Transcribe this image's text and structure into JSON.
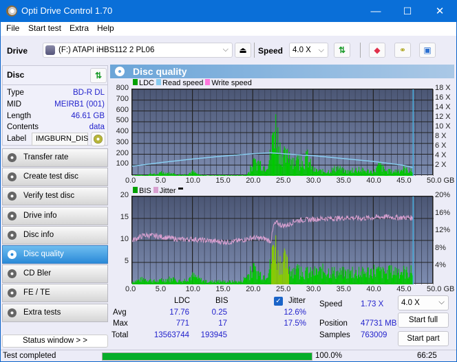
{
  "window": {
    "title": "Opti Drive Control 1.70",
    "minimize": "—",
    "maximize": "☐",
    "close": "✕"
  },
  "menu": [
    "File",
    "Start test",
    "Extra",
    "Help"
  ],
  "toolbar": {
    "drive_label": "Drive",
    "drive_value": "(F:)  ATAPI iHBS112  2 PL06",
    "speed_label": "Speed",
    "speed_value": "4.0 X",
    "icons": [
      "eject-icon",
      "refresh-icon",
      "eraser-icon",
      "copy-icon",
      "save-icon"
    ]
  },
  "disc": {
    "header": "Disc",
    "fields": [
      {
        "label": "Type",
        "value": "BD-R DL"
      },
      {
        "label": "MID",
        "value": "MEIRB1 (001)"
      },
      {
        "label": "Length",
        "value": "46.61 GB"
      },
      {
        "label": "Contents",
        "value": "data"
      }
    ],
    "label_label": "Label",
    "label_value": "IMGBURN_DIS"
  },
  "nav": [
    {
      "label": "Transfer rate",
      "active": false
    },
    {
      "label": "Create test disc",
      "active": false
    },
    {
      "label": "Verify test disc",
      "active": false
    },
    {
      "label": "Drive info",
      "active": false
    },
    {
      "label": "Disc info",
      "active": false
    },
    {
      "label": "Disc quality",
      "active": true
    },
    {
      "label": "CD Bler",
      "active": false
    },
    {
      "label": "FE / TE",
      "active": false
    },
    {
      "label": "Extra tests",
      "active": false
    }
  ],
  "status_window_button": "Status window > >",
  "panel_title": "Disc quality",
  "chart_data": [
    {
      "type": "bar",
      "title": "LDC / Read speed",
      "legend": [
        {
          "name": "LDC",
          "color": "#00a000"
        },
        {
          "name": "Read speed",
          "color": "#88ccf0"
        },
        {
          "name": "Write speed",
          "color": "#ff77dd"
        }
      ],
      "legend_position": "top-left",
      "xlabel": "GB",
      "xlim": [
        0,
        50
      ],
      "x_ticks": [
        "0.0",
        "5.0",
        "10.0",
        "15.0",
        "20.0",
        "25.0",
        "30.0",
        "35.0",
        "40.0",
        "45.0",
        "50.0 GB"
      ],
      "ylim": [
        0,
        800
      ],
      "y_ticks": [
        "800",
        "700",
        "600",
        "500",
        "400",
        "300",
        "200",
        "100"
      ],
      "y2lim": [
        0,
        18
      ],
      "y2_ticks": [
        "18 X",
        "16 X",
        "14 X",
        "12 X",
        "10 X",
        "8 X",
        "6 X",
        "4 X",
        "2 X"
      ],
      "grid": true,
      "end_marker_x": 46.61,
      "series": [
        {
          "name": "LDC",
          "x": [
            0,
            1,
            2,
            3,
            4,
            5,
            6,
            7,
            8,
            9,
            10,
            11,
            12,
            13,
            14,
            15,
            16,
            17,
            18,
            19,
            20,
            21,
            22,
            23,
            23.5,
            24,
            24.5,
            25,
            25.5,
            26,
            27,
            28,
            29,
            30,
            31,
            32,
            33,
            34,
            35,
            36,
            37,
            38,
            39,
            40,
            41,
            42,
            43,
            44,
            45,
            46,
            46.6
          ],
          "values": [
            5,
            15,
            10,
            30,
            20,
            50,
            40,
            20,
            15,
            25,
            60,
            15,
            10,
            8,
            10,
            12,
            10,
            10,
            12,
            15,
            160,
            200,
            120,
            300,
            771,
            600,
            380,
            300,
            250,
            330,
            200,
            180,
            250,
            80,
            70,
            60,
            80,
            120,
            70,
            60,
            90,
            80,
            70,
            60,
            150,
            70,
            60,
            80,
            100,
            70,
            60
          ]
        },
        {
          "name": "Read speed",
          "unit": "X",
          "x": [
            0,
            5,
            10,
            15,
            20,
            23,
            25,
            30,
            35,
            40,
            45,
            46.6
          ],
          "values": [
            2.0,
            2.8,
            3.5,
            4.1,
            4.6,
            4.8,
            4.6,
            4.2,
            3.6,
            3.0,
            2.2,
            1.73
          ]
        }
      ]
    },
    {
      "type": "bar",
      "title": "BIS / Jitter",
      "legend": [
        {
          "name": "BIS",
          "color": "#00a000"
        },
        {
          "name": "Jitter",
          "color": "#d8a0d0"
        }
      ],
      "legend_position": "top-left",
      "xlabel": "GB",
      "xlim": [
        0,
        50
      ],
      "x_ticks": [
        "0.0",
        "5.0",
        "10.0",
        "15.0",
        "20.0",
        "25.0",
        "30.0",
        "35.0",
        "40.0",
        "45.0",
        "50.0 GB"
      ],
      "ylim": [
        0,
        20
      ],
      "y_ticks": [
        "20",
        "15",
        "10",
        "5"
      ],
      "y2lim": [
        0,
        20
      ],
      "y2_ticks": [
        "20%",
        "16%",
        "12%",
        "8%",
        "4%"
      ],
      "grid": true,
      "end_marker_x": 46.61,
      "series": [
        {
          "name": "BIS",
          "x": [
            0,
            2,
            4,
            6,
            8,
            10,
            12,
            14,
            16,
            18,
            20,
            22,
            23,
            23.5,
            24,
            24.5,
            25,
            26,
            27,
            28,
            30,
            32,
            34,
            36,
            38,
            40,
            42,
            44,
            46,
            46.6
          ],
          "values": [
            1,
            2,
            1,
            2,
            1,
            3,
            1,
            1,
            1,
            1,
            5,
            3,
            7,
            17,
            10,
            8,
            9,
            6,
            5,
            4,
            4,
            5,
            4,
            4,
            4,
            5,
            4,
            5,
            4,
            5
          ]
        },
        {
          "name": "Jitter",
          "unit": "%",
          "x": [
            0,
            1,
            2,
            4,
            6,
            8,
            10,
            12,
            14,
            16,
            18,
            20,
            22,
            23,
            23.5,
            24,
            25,
            26,
            27,
            28,
            30,
            32,
            34,
            36,
            38,
            40,
            42,
            44,
            46,
            46.6
          ],
          "values": [
            10.0,
            10.6,
            11.2,
            11.0,
            10.6,
            10.2,
            10.3,
            10.0,
            9.8,
            9.6,
            10.0,
            10.6,
            10.4,
            9.8,
            13.5,
            14.0,
            13.3,
            13.6,
            14.5,
            14.6,
            14.8,
            15.0,
            15.0,
            15.2,
            15.0,
            15.2,
            15.4,
            15.2,
            15.2,
            15.0
          ]
        }
      ]
    }
  ],
  "stats": {
    "col_ldc": "LDC",
    "col_bis": "BIS",
    "jitter_label": "Jitter",
    "jitter_checked": true,
    "rows": [
      {
        "label": "Avg",
        "ldc": "17.76",
        "bis": "0.25",
        "jitter": "12.6%"
      },
      {
        "label": "Max",
        "ldc": "771",
        "bis": "17",
        "jitter": "17.5%"
      },
      {
        "label": "Total",
        "ldc": "13563744",
        "bis": "193945"
      }
    ],
    "speed_label": "Speed",
    "speed_value": "1.73 X",
    "position_label": "Position",
    "position_value": "47731 MB",
    "samples_label": "Samples",
    "samples_value": "763009",
    "speed_select": "4.0 X",
    "start_full": "Start full",
    "start_part": "Start part"
  },
  "statusbar": {
    "text": "Test completed",
    "progress_percent": 100,
    "progress_label": "100.0%",
    "time": "66:25"
  }
}
